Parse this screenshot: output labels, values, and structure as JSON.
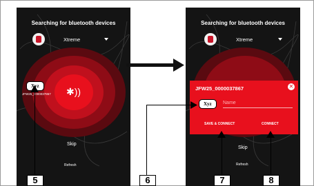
{
  "screens": {
    "left": {
      "title": "Searching for bluetooth devices",
      "device_selector": "Xtreme",
      "found_device": {
        "label": "Xyz",
        "sublabel": "JFW25_0000037867"
      },
      "skip": "Skip",
      "refresh": "Refresh"
    },
    "right": {
      "title": "Searching for bluetooth devices",
      "device_selector": "Xtreme",
      "dialog": {
        "title": "JFW25_0000037867",
        "name_placeholder": "Name",
        "name_value": "Xyz",
        "save_connect": "SAVE & CONNECT",
        "connect": "CONNECT"
      },
      "skip": "Skip",
      "refresh": "Refresh"
    }
  },
  "callouts": [
    "5",
    "6",
    "7",
    "8"
  ],
  "colors": {
    "accent": "#e8101d",
    "phone_bg": "#141414"
  }
}
